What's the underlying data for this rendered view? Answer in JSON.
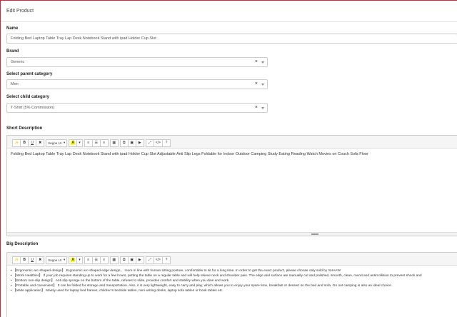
{
  "header": {
    "title": "Edit Product"
  },
  "name": {
    "label": "Name",
    "value": "Folding Bed Laptop Table Tray Lap Desk Notebook Stand with ipad Holder Cup Slot"
  },
  "brand": {
    "label": "Brand",
    "value": "Generic",
    "clear": "×"
  },
  "parent_category": {
    "label": "Select parent category",
    "value": "Men",
    "clear": "×"
  },
  "child_category": {
    "label": "Select child category",
    "value": "T-Shirt (5% Commission)",
    "clear": "×"
  },
  "toolbar": {
    "magic": "✨",
    "bold": "B",
    "underline": "U",
    "eraser": "✖",
    "font": "Segoe UI",
    "color": "A",
    "ul": "≡",
    "ol": "☰",
    "paragraph": "≡",
    "table": "▦",
    "link": "⧉",
    "image": "▣",
    "video": "▶",
    "fullscreen": "⤢",
    "code": "</>",
    "help": "?"
  },
  "short_description": {
    "label": "Short Description",
    "text": "Folding Bed Laptop Table Tray Lap Desk Notebook Stand with ipad Holder Cup Slot Adjustable Anti Slip Legs Foldable for Indoor Outdoor Camping Study Eating Reading Watch Movies on Couch Sofa Floor"
  },
  "big_description": {
    "label": "Big Description",
    "items": [
      "【Ergonomic arc-shaped design】 Ergonomic arc-shaped edge design，  more in line with human sitting posture, comfortable to sit for a long time. In order to get the exact product, please choose only sold by SHAAW",
      "【Work Healthier】 If your job requires standing up to work for a few hours, putting the table on a regular table and will help relieve neck and shoulder pain. The edge and surface are manually cut and polished, smooth, clean, round and antircollision to prevent shock and",
      "【Bottom non-slip design】 Anti slip sponge on the bottom of the table, refuses to slide, provides comfort and stability when you dine and work.",
      "【Portable and convenient】 It can be folded for storage and transportation. Also, it is very lightweight, easy to carry and play, which allows you to enjoy your spare time, breakfast or dessert on the bed and sofa. Go out camping is also an ideal choice.",
      "【Wide application】 Mainly used for laptop bed frames, children's bedside tables, mini writing desks, laptop sofa tables or book tables etc."
    ]
  }
}
